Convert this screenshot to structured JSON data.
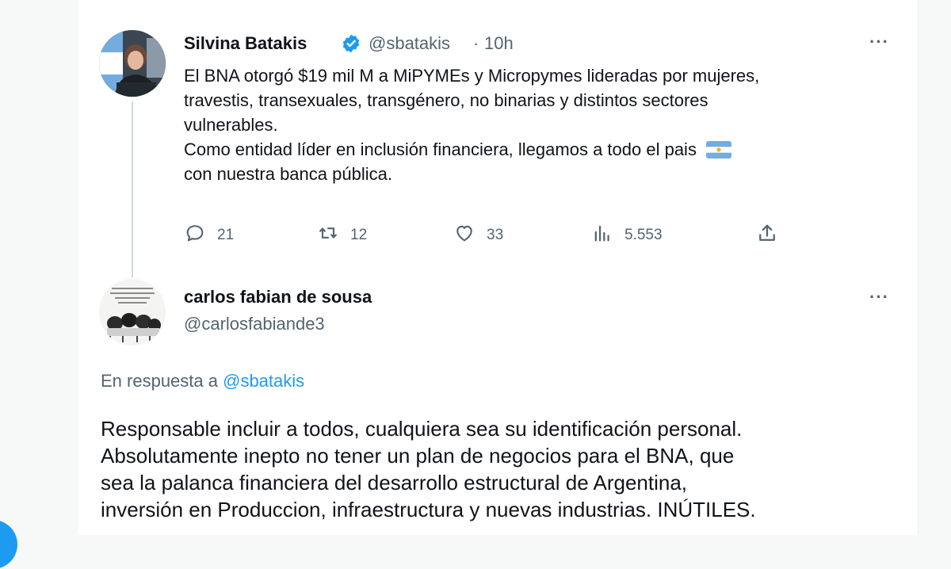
{
  "tweet": {
    "author_name": "Silvina Batakis",
    "verified_icon": "verified-badge-icon",
    "handle": "@sbatakis",
    "separator": "·",
    "time": "10h",
    "more_icon": "more-horizontal-icon",
    "text_lines": [
      "El BNA otorgó $19 mil M a MiPYMEs y Micropymes lideradas por mujeres,",
      "travestis, transexuales, transgénero, no binarias y distintos sectores",
      "vulnerables.",
      "Como entidad  líder en inclusión financiera, llegamos a todo el pais",
      "con nuestra banca pública."
    ],
    "flag_emoji": "argentina-flag",
    "actions": {
      "replies": "21",
      "retweets": "12",
      "likes": "33",
      "views": "5.553"
    }
  },
  "reply": {
    "author_name": "carlos fabian de sousa",
    "handle": "@carlosfabiande3",
    "more_icon": "more-horizontal-icon",
    "in_reply_to_prefix": "En respuesta a",
    "in_reply_to_handle": "@sbatakis",
    "text_lines": [
      "Responsable incluir a todos, cualquiera sea su identificación personal.",
      "Absolutamente inepto no tener un plan de negocios para el BNA, que",
      "sea la palanca financiera del desarrollo estructural de Argentina,",
      "inversión en Produccion, infraestructura y nuevas industrias. INÚTILES."
    ]
  },
  "colors": {
    "accent": "#1d9bf0",
    "text_primary": "#0f1419",
    "text_secondary": "#536471",
    "thread_line": "#cfd9de"
  }
}
